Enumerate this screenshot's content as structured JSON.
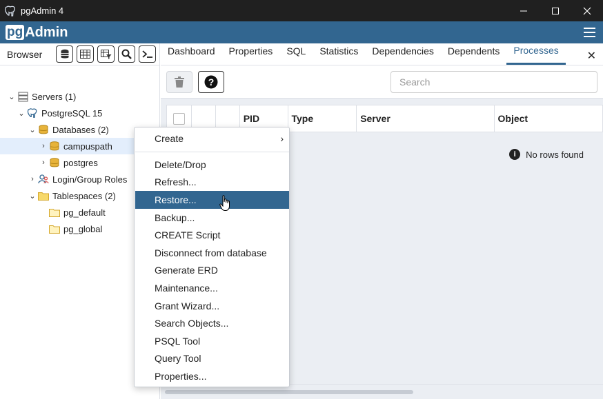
{
  "window": {
    "title": "pgAdmin 4"
  },
  "appbar": {
    "logo_pg": "pg",
    "logo_admin": "Admin"
  },
  "browser": {
    "tab_label": "Browser",
    "tree": [
      {
        "label": "Servers (1)",
        "icon": "servers-icon",
        "expanded": true
      },
      {
        "label": "PostgreSQL 15",
        "icon": "elephant-icon",
        "expanded": true
      },
      {
        "label": "Databases (2)",
        "icon": "database-icon",
        "expanded": true
      },
      {
        "label": "campuspath",
        "icon": "database-icon",
        "expanded": false,
        "selected": true
      },
      {
        "label": "postgres",
        "icon": "database-icon",
        "expanded": false
      },
      {
        "label": "Login/Group Roles",
        "icon": "roles-icon",
        "expanded": false
      },
      {
        "label": "Tablespaces (2)",
        "icon": "folder-icon",
        "expanded": true
      },
      {
        "label": "pg_default",
        "icon": "folder-icon"
      },
      {
        "label": "pg_global",
        "icon": "folder-icon"
      }
    ]
  },
  "tabs": [
    "Dashboard",
    "Properties",
    "SQL",
    "Statistics",
    "Dependencies",
    "Dependents",
    "Processes"
  ],
  "active_tab": "Processes",
  "search": {
    "placeholder": "Search"
  },
  "grid": {
    "columns": [
      "PID",
      "Type",
      "Server",
      "Object"
    ],
    "empty_message": "No rows found"
  },
  "context_menu": {
    "items": [
      "Create",
      "Delete/Drop",
      "Refresh...",
      "Restore...",
      "Backup...",
      "CREATE Script",
      "Disconnect from database",
      "Generate ERD",
      "Maintenance...",
      "Grant Wizard...",
      "Search Objects...",
      "PSQL Tool",
      "Query Tool",
      "Properties..."
    ],
    "highlighted": "Restore..."
  },
  "colors": {
    "brand": "#326690",
    "titlebar": "#202020",
    "panel_bg": "#ebeef3"
  }
}
